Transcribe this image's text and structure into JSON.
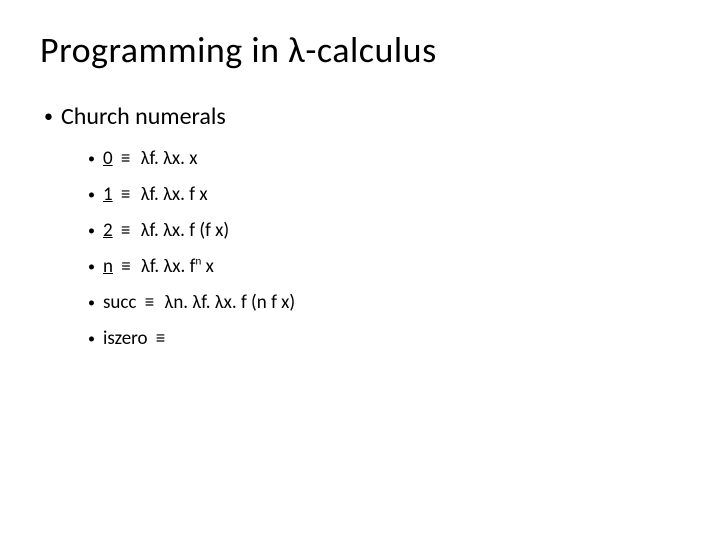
{
  "title_part1": "Programming in ",
  "title_lambda": "λ",
  "title_part2": "-calculus",
  "heading": "Church numerals",
  "def_sym": "≡",
  "items": [
    {
      "name": "0",
      "underline": true,
      "body": "λf. λx. x"
    },
    {
      "name": "1",
      "underline": true,
      "body": "λf. λx. f x"
    },
    {
      "name": "2",
      "underline": true,
      "body": "λf. λx. f (f x)"
    },
    {
      "name": "n",
      "underline": true,
      "body_prefix": "λf. λx. f",
      "body_sup": "n",
      "body_suffix": " x"
    },
    {
      "name": "succ",
      "underline": false,
      "body": "λn. λf. λx. f (n f x)"
    },
    {
      "name": "iszero",
      "underline": false,
      "body": ""
    }
  ]
}
